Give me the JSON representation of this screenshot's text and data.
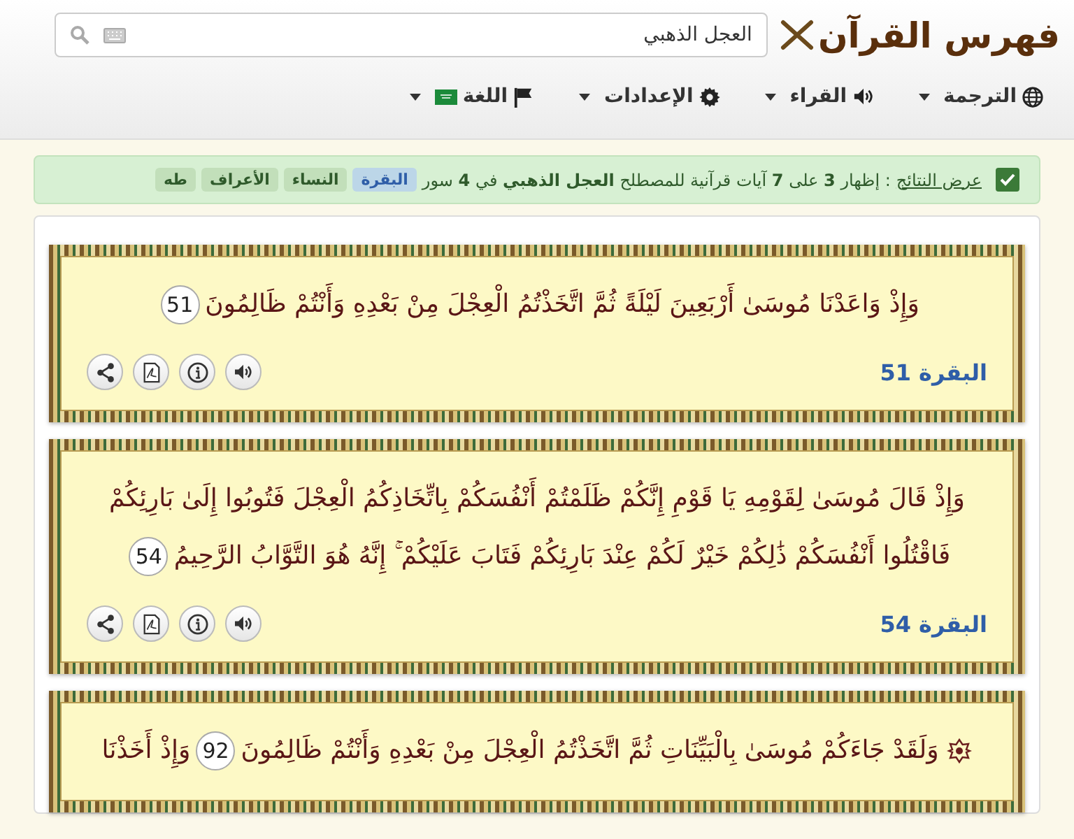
{
  "header": {
    "logo": "فهرس القرآن",
    "search": {
      "value": "العجل الذهبي"
    }
  },
  "menu": [
    {
      "kind": "globe",
      "label": "الترجمة"
    },
    {
      "kind": "speaker",
      "label": "القراء"
    },
    {
      "kind": "gear",
      "label": "الإعدادات"
    },
    {
      "kind": "flag",
      "label": "اللغة"
    }
  ],
  "summary": {
    "checked": true,
    "label": "عرض النتائج",
    "text": ": إظهار **3** على **7** آيات قرآنية للمصطلح **العجل الذهبي** في **4** سور",
    "tags": [
      {
        "label": "البقرة",
        "selected": true
      },
      {
        "label": "النساء",
        "selected": false
      },
      {
        "label": "الأعراف",
        "selected": false
      },
      {
        "label": "طه",
        "selected": false
      }
    ]
  },
  "verses": [
    {
      "parts": [
        {
          "kind": "text",
          "text": "وَإِذْ وَاعَدْنَا مُوسَىٰ أَرْبَعِينَ لَيْلَةً ثُمَّ اتَّخَذْتُمُ الْعِجْلَ مِنْ بَعْدِهِ وَأَنْتُمْ ظَالِمُونَ"
        },
        {
          "kind": "number",
          "text": "51"
        }
      ],
      "reference": "البقرة 51"
    },
    {
      "parts": [
        {
          "kind": "text",
          "text": "وَإِذْ قَالَ مُوسَىٰ لِقَوْمِهِ يَا قَوْمِ إِنَّكُمْ ظَلَمْتُمْ أَنْفُسَكُمْ بِاتِّخَاذِكُمُ الْعِجْلَ فَتُوبُوا إِلَىٰ بَارِئِكُمْ"
        },
        {
          "kind": "text",
          "text": "فَاقْتُلُوا أَنْفُسَكُمْ ذَٰلِكُمْ خَيْرٌ لَكُمْ عِنْدَ بَارِئِكُمْ فَتَابَ عَلَيْكُمْ ۚ إِنَّهُ هُوَ التَّوَّابُ الرَّحِيمُ"
        },
        {
          "kind": "number",
          "text": "54"
        }
      ],
      "reference": "البقرة 54"
    },
    {
      "parts": [
        {
          "kind": "hizb"
        },
        {
          "kind": "text",
          "text": "وَلَقَدْ جَاءَكُمْ مُوسَىٰ بِالْبَيِّنَاتِ ثُمَّ اتَّخَذْتُمُ الْعِجْلَ مِنْ بَعْدِهِ وَأَنْتُمْ ظَالِمُونَ"
        },
        {
          "kind": "number",
          "text": "92"
        },
        {
          "kind": "text",
          "text": "وَإِذْ أَخَذْنَا"
        }
      ]
    }
  ]
}
